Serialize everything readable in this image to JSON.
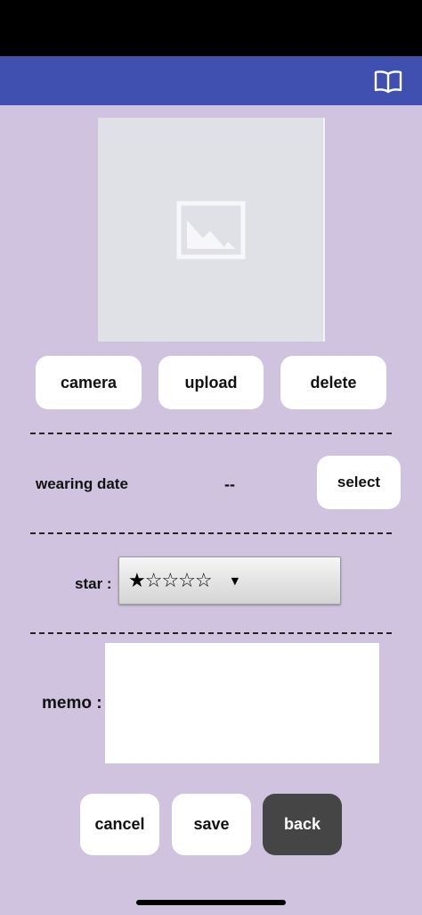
{
  "header": {
    "book_icon": "book-open-icon"
  },
  "photo": {
    "icon": "image-placeholder-icon"
  },
  "photo_actions": {
    "camera": "camera",
    "upload": "upload",
    "delete": "delete"
  },
  "wearing": {
    "label": "wearing date",
    "value": "--",
    "select": "select"
  },
  "rating": {
    "label": "star :",
    "selected": "★☆☆☆☆",
    "rating_value": 1,
    "rating_max": 5
  },
  "memo": {
    "label": "memo :",
    "value": ""
  },
  "footer": {
    "cancel": "cancel",
    "save": "save",
    "back": "back"
  },
  "colors": {
    "background": "#d0c3df",
    "nav": "#4050b0",
    "back_button": "#454545"
  }
}
